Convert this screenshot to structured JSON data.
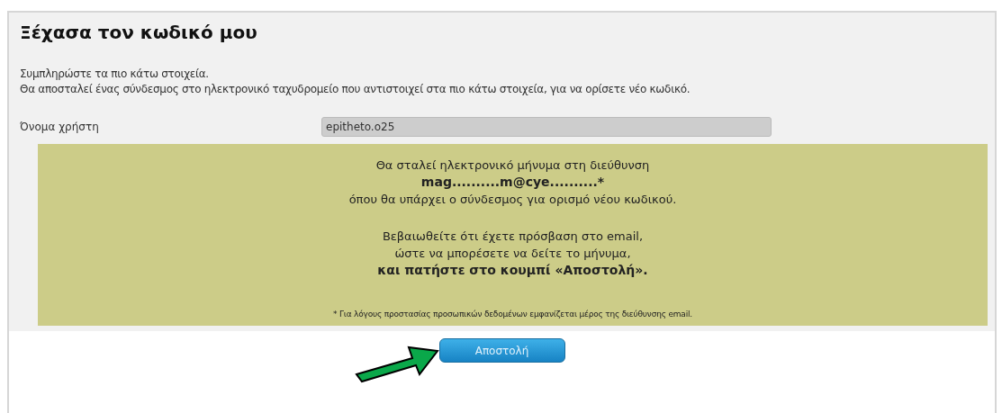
{
  "page": {
    "title": "Ξέχασα τον κωδικό μου"
  },
  "intro": [
    "Συμπληρώστε τα πιο κάτω στοιχεία.",
    "Θα αποσταλεί ένας σύνδεσμος στο ηλεκτρονικό ταχυδρομείο που αντιστοιχεί στα πιο κάτω στοιχεία, για να ορίσετε νέο κωδικό."
  ],
  "username": {
    "label": "Όνομα χρήστη",
    "value": "epitheto.o25",
    "disabled": true
  },
  "notice": {
    "paragraphs": [
      {
        "lines": [
          {
            "text": "Θα σταλεί ηλεκτρονικό μήνυμα στη διεύθυνση",
            "bold": false
          },
          {
            "text": "mag..........m@cye..........*",
            "bold": true
          },
          {
            "text": "όπου θα υπάρχει ο σύνδεσμος για ορισμό νέου κωδικού.",
            "bold": false
          }
        ]
      },
      {
        "lines": [
          {
            "text": "Βεβαιωθείτε ότι έχετε πρόσβαση στο email,",
            "bold": false
          },
          {
            "text": "ώστε να μπορέσετε να δείτε το μήνυμα,",
            "bold": false
          },
          {
            "text": "και πατήστε στο κουμπί «Αποστολή».",
            "bold": true
          }
        ]
      }
    ],
    "footnote": "* Για λόγους προστασίας προσωπικών δεδομένων εμφανίζεται μέρος της διεύθυνσης email."
  },
  "submit_button": {
    "label": "Αποστολή"
  }
}
